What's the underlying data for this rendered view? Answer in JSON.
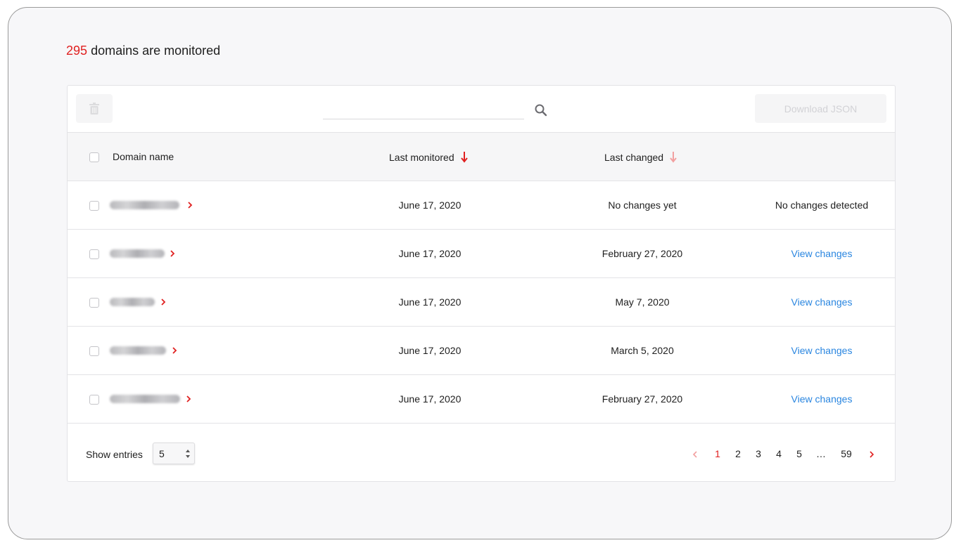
{
  "summary": {
    "count": "295",
    "text": "domains are monitored"
  },
  "toolbar": {
    "search_placeholder": "",
    "download_label": "Download JSON"
  },
  "table": {
    "headers": {
      "domain": "Domain name",
      "last_monitored": "Last monitored",
      "last_changed": "Last changed"
    },
    "rows": [
      {
        "last_monitored": "June 17, 2020",
        "last_changed": "No changes yet",
        "action": "No changes detected",
        "action_is_link": false
      },
      {
        "last_monitored": "June 17, 2020",
        "last_changed": "February 27, 2020",
        "action": "View changes",
        "action_is_link": true
      },
      {
        "last_monitored": "June 17, 2020",
        "last_changed": "May 7, 2020",
        "action": "View changes",
        "action_is_link": true
      },
      {
        "last_monitored": "June 17, 2020",
        "last_changed": "March 5, 2020",
        "action": "View changes",
        "action_is_link": true
      },
      {
        "last_monitored": "June 17, 2020",
        "last_changed": "February 27, 2020",
        "action": "View changes",
        "action_is_link": true
      }
    ]
  },
  "footer": {
    "show_entries_label": "Show entries",
    "entries_value": "5",
    "pages": [
      "1",
      "2",
      "3",
      "4",
      "5",
      "…",
      "59"
    ],
    "current_page": "1"
  },
  "colors": {
    "accent_red": "#e02020",
    "link_blue": "#2a86e0"
  },
  "icons": {
    "delete": "trash-icon",
    "search": "search-icon",
    "sort": "arrow-down-icon",
    "expand": "chevron-right-icon"
  }
}
